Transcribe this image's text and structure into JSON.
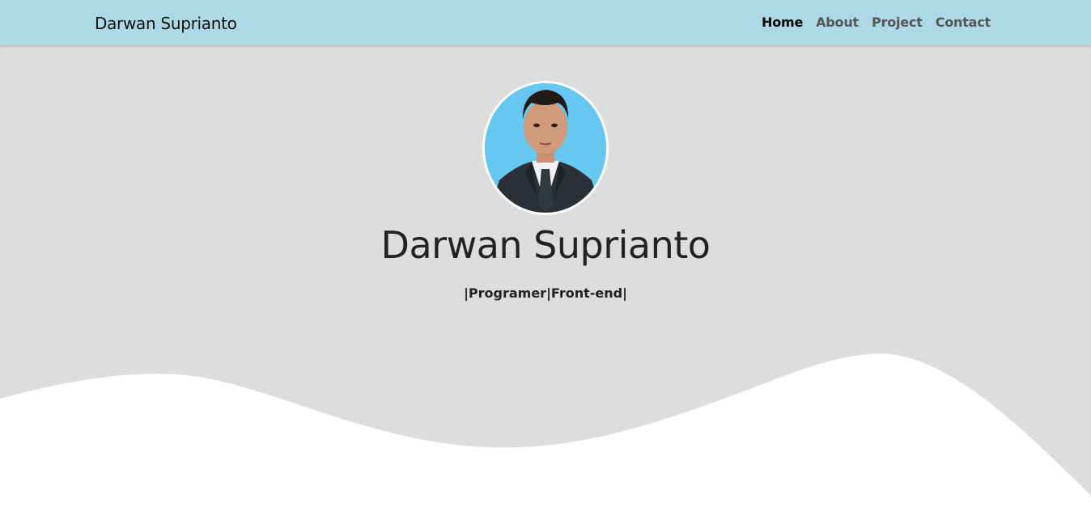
{
  "navbar": {
    "brand": "Darwan Suprianto",
    "links": [
      {
        "label": "Home",
        "active": true
      },
      {
        "label": "About",
        "active": false
      },
      {
        "label": "Project",
        "active": false
      },
      {
        "label": "Contact",
        "active": false
      }
    ],
    "background": "#add8e6"
  },
  "hero": {
    "name": "Darwan Suprianto",
    "subtitle": "|Programer|Front-end|",
    "background": "#dddddd",
    "photo_background": "#66c8f0"
  }
}
